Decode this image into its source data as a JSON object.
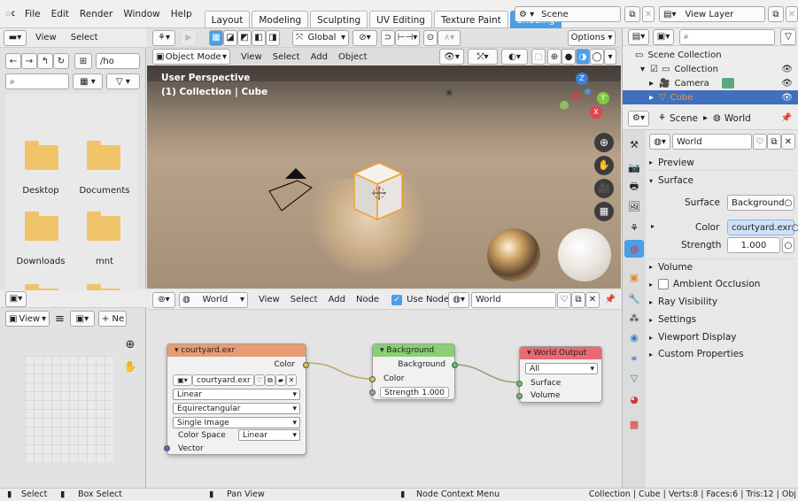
{
  "topbar": {
    "menus": [
      "File",
      "Edit",
      "Render",
      "Window",
      "Help"
    ],
    "workspaces": [
      "Layout",
      "Modeling",
      "Sculpting",
      "UV Editing",
      "Texture Paint",
      "Shading"
    ],
    "active_workspace": "Shading",
    "scene_label": "Scene",
    "view_layer_label": "View Layer"
  },
  "file_browser": {
    "menus": [
      "View",
      "Select"
    ],
    "path": "/ho",
    "folders": [
      "Desktop",
      "Documents",
      "Downloads",
      "mnt"
    ]
  },
  "viewport": {
    "mode": "Object Mode",
    "menus": [
      "View",
      "Select",
      "Add",
      "Object"
    ],
    "orientation": "Global",
    "options_label": "Options",
    "info_line1": "User Perspective",
    "info_line2": "(1) Collection | Cube"
  },
  "outliner": {
    "items": [
      "Scene Collection",
      "Collection",
      "Camera",
      "Cube"
    ]
  },
  "properties": {
    "breadcrumb_scene": "Scene",
    "breadcrumb_world": "World",
    "world_name": "World",
    "panels": [
      "Preview",
      "Surface"
    ],
    "surface_label": "Surface",
    "surface_value": "Background",
    "color_label": "Color",
    "color_value": "courtyard.exr",
    "strength_label": "Strength",
    "strength_value": "1.000",
    "more_panels": [
      "Volume",
      "Ambient Occlusion",
      "Ray Visibility",
      "Settings",
      "Viewport Display",
      "Custom Properties"
    ]
  },
  "node_editor": {
    "header_world": "World",
    "menus": [
      "View",
      "Select",
      "Add",
      "Node"
    ],
    "use_nodes_label": "Use Nodes",
    "world_field": "World",
    "tex_node": {
      "title": "courtyard.exr",
      "out_color": "Color",
      "image_name": "courtyard.exr",
      "interpolation": "Linear",
      "projection": "Equirectangular",
      "source": "Single Image",
      "colorspace_label": "Color Space",
      "colorspace_value": "Linear",
      "in_vector": "Vector"
    },
    "bg_node": {
      "title": "Background",
      "out_label": "Background",
      "in_color": "Color",
      "strength_label": "Strength",
      "strength_value": "1.000"
    },
    "out_node": {
      "title": "World Output",
      "target": "All",
      "in_surface": "Surface",
      "in_volume": "Volume"
    }
  },
  "image_editor": {
    "view_label": "View",
    "new_label": "Ne"
  },
  "statusbar": {
    "select": "Select",
    "box_select": "Box Select",
    "pan_view": "Pan View",
    "context_menu": "Node Context Menu",
    "stats": "Collection | Cube | Verts:8 | Faces:6 | Tris:12 | Obj"
  },
  "colors": {
    "accent": "#4a9fe8",
    "tex_node_header": "#e79b73",
    "bg_node_header": "#89cf74",
    "out_node_header": "#e86a72",
    "folder": "#f0c469"
  }
}
